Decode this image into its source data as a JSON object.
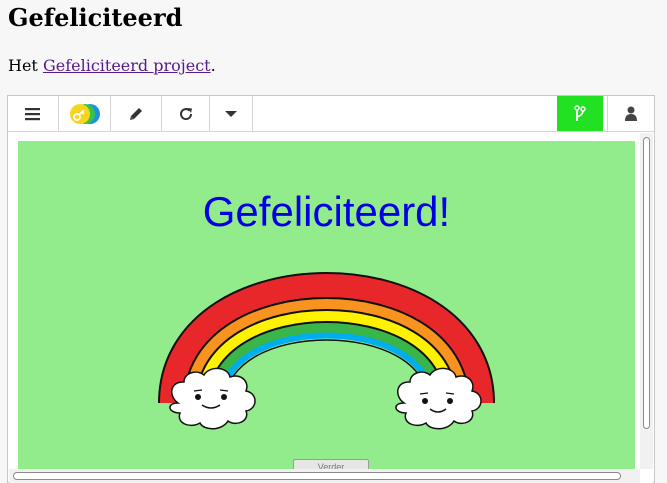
{
  "page": {
    "title": "Gefeliciteerd",
    "intro_prefix": "Het ",
    "intro_link": "Gefeliciteerd project",
    "intro_suffix": "."
  },
  "toolbar": {
    "buttons": [
      {
        "name": "menu",
        "icon": "hamburger-icon"
      },
      {
        "name": "keys",
        "icon": "key-circles-icon"
      },
      {
        "name": "edit",
        "icon": "pencil-icon"
      },
      {
        "name": "reload",
        "icon": "reload-icon"
      },
      {
        "name": "dropdown",
        "icon": "caret-down-icon"
      },
      {
        "name": "git",
        "icon": "git-branch-icon"
      },
      {
        "name": "user",
        "icon": "user-icon"
      }
    ],
    "git_color": "#22e022"
  },
  "stage": {
    "title": "Gefeliciteerd!",
    "background": "#93ec8b",
    "title_color": "#0000e6",
    "next_button": "Verder"
  },
  "colors": {
    "rainbow": [
      "#e8272a",
      "#f7931e",
      "#fff200",
      "#39b54a",
      "#00aeef"
    ]
  }
}
